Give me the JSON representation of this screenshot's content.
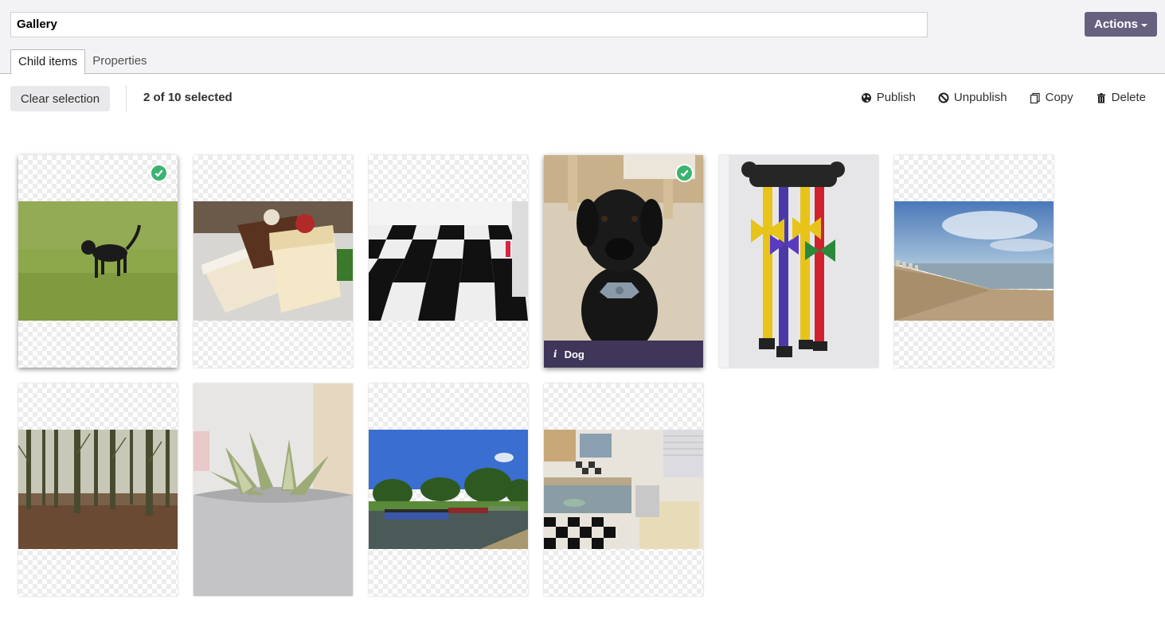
{
  "header": {
    "name_value": "Gallery",
    "actions_label": "Actions"
  },
  "tabs": [
    {
      "label": "Child items",
      "active": true
    },
    {
      "label": "Properties",
      "active": false
    }
  ],
  "toolbar": {
    "clear_label": "Clear selection",
    "selection_text": "2 of 10 selected",
    "actions": [
      {
        "label": "Publish",
        "icon": "globe-icon"
      },
      {
        "label": "Unpublish",
        "icon": "prohibited-icon"
      },
      {
        "label": "Copy",
        "icon": "copy-icon"
      },
      {
        "label": "Delete",
        "icon": "trash-icon"
      }
    ]
  },
  "items": [
    {
      "subject": "black dog on grass",
      "selected": true
    },
    {
      "subject": "cake slices",
      "selected": false
    },
    {
      "subject": "checkered floor",
      "selected": false
    },
    {
      "subject": "black labrador",
      "selected": true,
      "caption": "Dog"
    },
    {
      "subject": "dog collars and bow ties",
      "selected": false
    },
    {
      "subject": "beach",
      "selected": false
    },
    {
      "subject": "woodland",
      "selected": false
    },
    {
      "subject": "succulent plant",
      "selected": false
    },
    {
      "subject": "canal boats",
      "selected": false
    },
    {
      "subject": "kitchen",
      "selected": false
    }
  ],
  "colors": {
    "accent": "#68607f",
    "caption_bg": "#3f3659",
    "check": "#3cb371"
  }
}
